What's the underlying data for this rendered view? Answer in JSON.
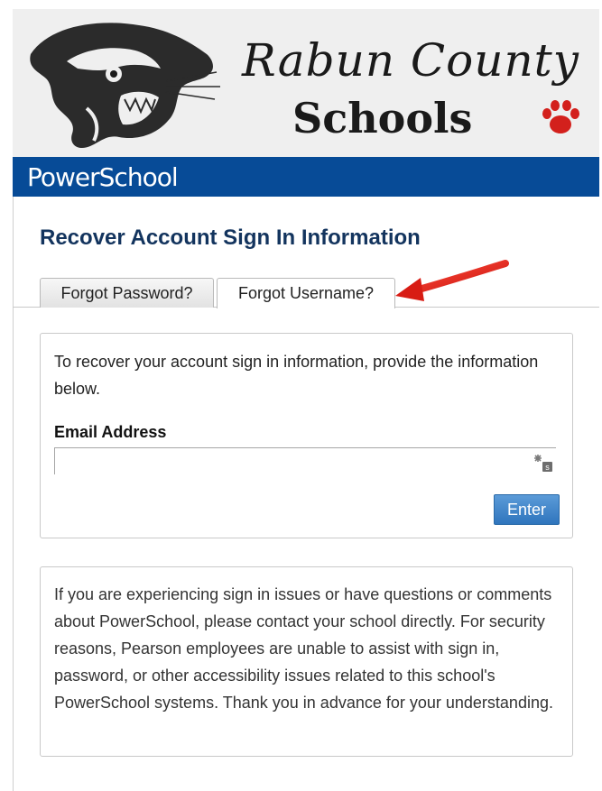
{
  "header": {
    "brand_script": "Rabun County",
    "brand_schools": "Schools",
    "logo_icon": "panther-head-icon",
    "paw_icon": "paw-print-icon",
    "paw_color": "#d3201c"
  },
  "app_bar": {
    "title": "PowerSchool",
    "color": "#074b97"
  },
  "page": {
    "title": "Recover Account Sign In Information"
  },
  "tabs": [
    {
      "label": "Forgot Password?",
      "active": false
    },
    {
      "label": "Forgot Username?",
      "active": true
    }
  ],
  "annotation": {
    "arrow_icon": "red-arrow-icon",
    "color": "#e0201a"
  },
  "form": {
    "intro": "To recover your account sign in information, provide the information below.",
    "email_label": "Email Address",
    "email_value": "",
    "email_placeholder": "",
    "key_icon": "password-key-icon",
    "submit_label": "Enter",
    "submit_color": "#3a80c6"
  },
  "notice": {
    "text": "If you are experiencing sign in issues or have questions or comments about PowerSchool, please contact your school directly. For security reasons, Pearson employees are unable to assist with sign in, password, or other accessibility issues related to this school's PowerSchool systems. Thank you in advance for your understanding."
  }
}
